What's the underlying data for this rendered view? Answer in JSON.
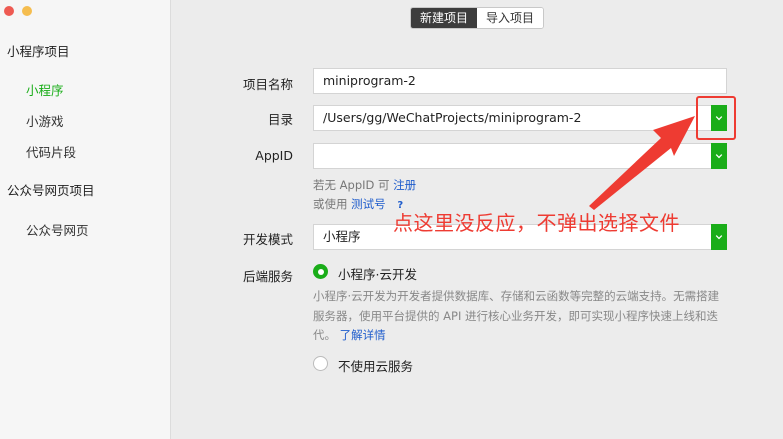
{
  "sidebar": {
    "groups": [
      {
        "title": "小程序项目",
        "items": [
          "小程序",
          "小游戏",
          "代码片段"
        ]
      },
      {
        "title": "公众号网页项目",
        "items": [
          "公众号网页"
        ]
      }
    ]
  },
  "tabs": [
    "新建项目",
    "导入项目"
  ],
  "form": {
    "project_name_label": "项目名称",
    "project_name_value": "miniprogram-2",
    "directory_label": "目录",
    "directory_value": "/Users/gg/WeChatProjects/miniprogram-2",
    "appid_label": "AppID",
    "appid_value": "",
    "appid_hint_prefix": "若无 AppID 可",
    "appid_hint_register": "注册",
    "appid_hint_or": "或使用",
    "appid_hint_test": "测试号",
    "appid_hint_help": "?",
    "dev_mode_label": "开发模式",
    "dev_mode_value": "小程序",
    "backend_label": "后端服务",
    "backend_option_cloud": "小程序·云开发",
    "backend_desc": "小程序·云开发为开发者提供数据库、存储和云函数等完整的云端支持。无需搭建服务器，使用平台提供的 API 进行核心业务开发，即可实现小程序快速上线和迭代。",
    "backend_learn_more": "了解详情",
    "backend_option_none": "不使用云服务"
  },
  "annotation": {
    "callout": "点这里没反应，不弹出选择文件",
    "color": "#ee3b32"
  },
  "colors": {
    "accent": "#1aad19",
    "link": "#1e5ccc"
  }
}
